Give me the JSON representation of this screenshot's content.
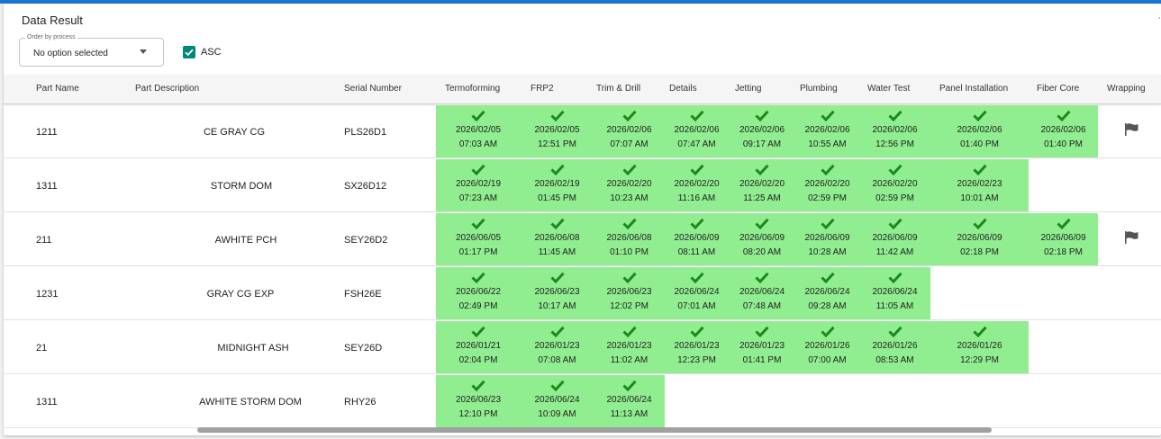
{
  "header": {
    "title": "Data Result"
  },
  "controls": {
    "order_legend": "Order by process",
    "order_value": "No option selected",
    "asc_label": "ASC"
  },
  "columns": [
    "Part Name",
    "Part Description",
    "Serial Number",
    "Termoforming",
    "FRP2",
    "Trim & Drill",
    "Details",
    "Jetting",
    "Plumbing",
    "Water Test",
    "Panel Installation",
    "Fiber Core",
    "Wrapping"
  ],
  "rows": [
    {
      "part": "1211",
      "desc": "CE GRAY CG",
      "serial": "PLS26D1",
      "flag": true,
      "stamps": [
        {
          "date": "2026/02/05",
          "time": "07:03 AM"
        },
        {
          "date": "2026/02/05",
          "time": "12:51 PM"
        },
        {
          "date": "2026/02/06",
          "time": "07:07 AM"
        },
        {
          "date": "2026/02/06",
          "time": "07:47 AM"
        },
        {
          "date": "2026/02/06",
          "time": "09:17 AM"
        },
        {
          "date": "2026/02/06",
          "time": "10:55 AM"
        },
        {
          "date": "2026/02/06",
          "time": "12:56 PM"
        },
        {
          "date": "2026/02/06",
          "time": "01:40 PM"
        },
        {
          "date": "2026/02/06",
          "time": "01:40 PM"
        }
      ]
    },
    {
      "part": "1311",
      "desc": "STORM DOM",
      "serial": "SX26D12",
      "flag": false,
      "stamps": [
        {
          "date": "2026/02/19",
          "time": "07:23 AM"
        },
        {
          "date": "2026/02/19",
          "time": "01:45 PM"
        },
        {
          "date": "2026/02/20",
          "time": "10:23 AM"
        },
        {
          "date": "2026/02/20",
          "time": "11:16 AM"
        },
        {
          "date": "2026/02/20",
          "time": "11:25 AM"
        },
        {
          "date": "2026/02/20",
          "time": "02:59 PM"
        },
        {
          "date": "2026/02/20",
          "time": "02:59 PM"
        },
        {
          "date": "2026/02/23",
          "time": "10:01 AM"
        }
      ]
    },
    {
      "part": "211",
      "desc": "AWHITE PCH",
      "serial": "SEY26D2",
      "flag": true,
      "stamps": [
        {
          "date": "2026/06/05",
          "time": "01:17 PM"
        },
        {
          "date": "2026/06/08",
          "time": "11:45 AM"
        },
        {
          "date": "2026/06/08",
          "time": "01:10 PM"
        },
        {
          "date": "2026/06/09",
          "time": "08:11 AM"
        },
        {
          "date": "2026/06/09",
          "time": "08:20 AM"
        },
        {
          "date": "2026/06/09",
          "time": "10:28 AM"
        },
        {
          "date": "2026/06/09",
          "time": "11:42 AM"
        },
        {
          "date": "2026/06/09",
          "time": "02:18 PM"
        },
        {
          "date": "2026/06/09",
          "time": "02:18 PM"
        }
      ]
    },
    {
      "part": "1231",
      "desc": "GRAY CG EXP",
      "serial": "FSH26E",
      "flag": false,
      "stamps": [
        {
          "date": "2026/06/22",
          "time": "02:49 PM"
        },
        {
          "date": "2026/06/23",
          "time": "10:17 AM"
        },
        {
          "date": "2026/06/23",
          "time": "12:02 PM"
        },
        {
          "date": "2026/06/24",
          "time": "07:01 AM"
        },
        {
          "date": "2026/06/24",
          "time": "07:48 AM"
        },
        {
          "date": "2026/06/24",
          "time": "09:28 AM"
        },
        {
          "date": "2026/06/24",
          "time": "11:05 AM"
        }
      ]
    },
    {
      "part": "21",
      "desc": "MIDNIGHT ASH",
      "serial": "SEY26D",
      "flag": false,
      "stamps": [
        {
          "date": "2026/01/21",
          "time": "02:04 PM"
        },
        {
          "date": "2026/01/23",
          "time": "07:08 AM"
        },
        {
          "date": "2026/01/23",
          "time": "11:02 AM"
        },
        {
          "date": "2026/01/23",
          "time": "12:23 PM"
        },
        {
          "date": "2026/01/23",
          "time": "01:41 PM"
        },
        {
          "date": "2026/01/26",
          "time": "07:00 AM"
        },
        {
          "date": "2026/01/26",
          "time": "08:53 AM"
        },
        {
          "date": "2026/01/26",
          "time": "12:29 PM"
        }
      ]
    },
    {
      "part": "1311",
      "desc": "AWHITE STORM DOM",
      "serial": "RHY26",
      "flag": false,
      "stamps": [
        {
          "date": "2026/06/23",
          "time": "12:10 PM"
        },
        {
          "date": "2026/06/24",
          "time": "10:09 AM"
        },
        {
          "date": "2026/06/24",
          "time": "11:13 AM"
        }
      ]
    }
  ],
  "colors": {
    "accent": "#1976d2",
    "done_bg": "#90ee90",
    "check": "#1b8a1b",
    "checkbox": "#00897b"
  },
  "icons": {
    "done": "check-icon",
    "flag": "flag-icon",
    "dropdown": "caret-down-icon"
  }
}
